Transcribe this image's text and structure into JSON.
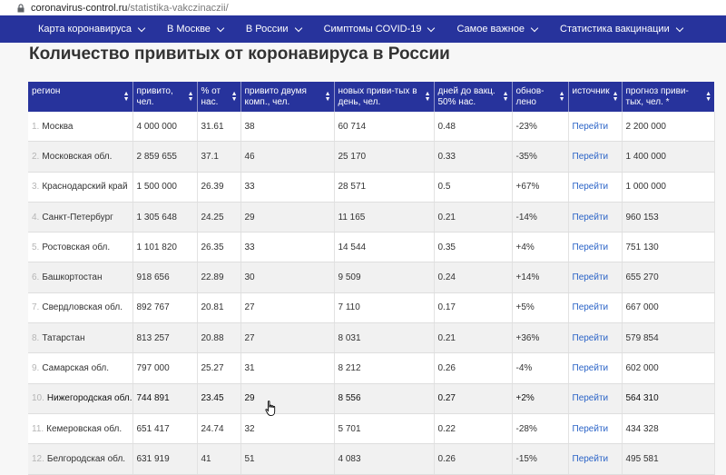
{
  "browser": {
    "url_host": "coronavirus-control.ru",
    "url_path": "/statistika-vakczinaczii/"
  },
  "nav": {
    "items": [
      {
        "label": "Карта коронавируса"
      },
      {
        "label": "В Москве"
      },
      {
        "label": "В России"
      },
      {
        "label": "Симптомы COVID-19"
      },
      {
        "label": "Самое важное"
      },
      {
        "label": "Статистика вакцинации"
      }
    ]
  },
  "page": {
    "title": "Количество привитых от коронавируса в России"
  },
  "table": {
    "headers": [
      "регион",
      "привито, чел.",
      "% от нас.",
      "привито двумя комп., чел.",
      "новых приви-тых в день, чел.",
      "дней до вакц. 50% нас.",
      "обнов-лено",
      "источник",
      "прогноз приви-тых, чел. *"
    ],
    "rows": [
      {
        "n": "1.",
        "region": "Москва",
        "vaccinated": "4 000 000",
        "pct": "31.61",
        "two": "38",
        "daily": "60 714",
        "days": "0.48",
        "upd": "-23%",
        "src": "Перейти",
        "forecast": "2 200 000"
      },
      {
        "n": "2.",
        "region": "Московская обл.",
        "vaccinated": "2 859 655",
        "pct": "37.1",
        "two": "46",
        "daily": "25 170",
        "days": "0.33",
        "upd": "-35%",
        "src": "Перейти",
        "forecast": "1 400 000"
      },
      {
        "n": "3.",
        "region": "Краснодарский край",
        "vaccinated": "1 500 000",
        "pct": "26.39",
        "two": "33",
        "daily": "28 571",
        "days": "0.5",
        "upd": "+67%",
        "src": "Перейти",
        "forecast": "1 000 000"
      },
      {
        "n": "4.",
        "region": "Санкт-Петербург",
        "vaccinated": "1 305 648",
        "pct": "24.25",
        "two": "29",
        "daily": "11 165",
        "days": "0.21",
        "upd": "-14%",
        "src": "Перейти",
        "forecast": "960 153"
      },
      {
        "n": "5.",
        "region": "Ростовская обл.",
        "vaccinated": "1 101 820",
        "pct": "26.35",
        "two": "33",
        "daily": "14 544",
        "days": "0.35",
        "upd": "+4%",
        "src": "Перейти",
        "forecast": "751 130"
      },
      {
        "n": "6.",
        "region": "Башкортостан",
        "vaccinated": "918 656",
        "pct": "22.89",
        "two": "30",
        "daily": "9 509",
        "days": "0.24",
        "upd": "+14%",
        "src": "Перейти",
        "forecast": "655 270"
      },
      {
        "n": "7.",
        "region": "Свердловская обл.",
        "vaccinated": "892 767",
        "pct": "20.81",
        "two": "27",
        "daily": "7 110",
        "days": "0.17",
        "upd": "+5%",
        "src": "Перейти",
        "forecast": "667 000"
      },
      {
        "n": "8.",
        "region": "Татарстан",
        "vaccinated": "813 257",
        "pct": "20.88",
        "two": "27",
        "daily": "8 031",
        "days": "0.21",
        "upd": "+36%",
        "src": "Перейти",
        "forecast": "579 854"
      },
      {
        "n": "9.",
        "region": "Самарская обл.",
        "vaccinated": "797 000",
        "pct": "25.27",
        "two": "31",
        "daily": "8 212",
        "days": "0.26",
        "upd": "-4%",
        "src": "Перейти",
        "forecast": "602 000"
      },
      {
        "n": "10.",
        "region": "Нижегородская обл.",
        "vaccinated": "744 891",
        "pct": "23.45",
        "two": "29",
        "daily": "8 556",
        "days": "0.27",
        "upd": "+2%",
        "src": "Перейти",
        "forecast": "564 310"
      },
      {
        "n": "11.",
        "region": "Кемеровская обл.",
        "vaccinated": "651 417",
        "pct": "24.74",
        "two": "32",
        "daily": "5 701",
        "days": "0.22",
        "upd": "-28%",
        "src": "Перейти",
        "forecast": "434 328"
      },
      {
        "n": "12.",
        "region": "Белгородская обл.",
        "vaccinated": "631 919",
        "pct": "41",
        "two": "51",
        "daily": "4 083",
        "days": "0.26",
        "upd": "-15%",
        "src": "Перейти",
        "forecast": "495 581"
      }
    ]
  },
  "colors": {
    "nav_bg": "#27339c",
    "link": "#2a63c7"
  },
  "icons": {
    "lock": "lock-icon",
    "chevron": "chevron-down-icon",
    "sort": "sort-icon",
    "cursor": "hand-pointer-icon"
  }
}
